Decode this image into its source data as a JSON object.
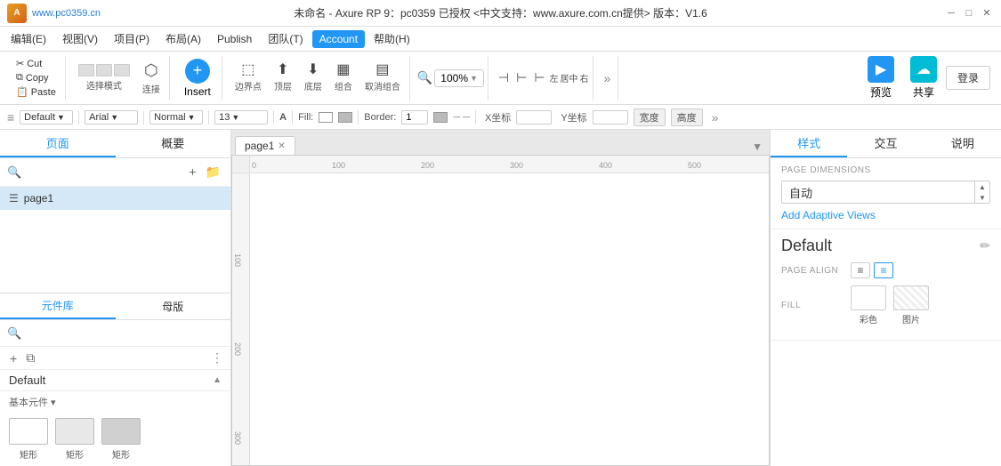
{
  "titlebar": {
    "logo_text": "A",
    "watermark": "www.pc0359.cn",
    "title": "未命名 - Axure RP 9：pc0359 已授权  <中文支持：www.axure.com.cn提供> 版本：V1.6",
    "win_controls": {
      "minimize": "─",
      "maximize": "□",
      "close": "✕"
    }
  },
  "menubar": {
    "items": [
      {
        "id": "file",
        "label": "编辑(E)"
      },
      {
        "id": "view",
        "label": "视图(V)"
      },
      {
        "id": "project",
        "label": "项目(P)"
      },
      {
        "id": "layout",
        "label": "布局(A)"
      },
      {
        "id": "publish",
        "label": "Publish"
      },
      {
        "id": "team",
        "label": "团队(T)"
      },
      {
        "id": "account",
        "label": "Account"
      },
      {
        "id": "help",
        "label": "帮助(H)"
      }
    ]
  },
  "toolbar": {
    "cut_label": "Cut",
    "copy_label": "Copy",
    "paste_label": "Paste",
    "select_mode_label": "选择模式",
    "connect_label": "连接",
    "insert_label": "Insert",
    "border_label": "边界点",
    "top_label": "顶层",
    "bottom_label": "底层",
    "group_label": "组合",
    "ungroup_label": "取消组合",
    "zoom_value": "100%",
    "left_label": "左",
    "center_label": "居中",
    "right_label": "右",
    "preview_label": "预览",
    "share_label": "共享",
    "login_label": "登录"
  },
  "formatbar": {
    "style_label": "Default",
    "font_label": "Arial",
    "style2_label": "Normal",
    "size_label": "13",
    "fill_label": "Fill:",
    "border_label": "Border:",
    "border_value": "1",
    "x_label": "X坐标",
    "y_label": "Y坐标",
    "width_label": "宽度",
    "height_label": "高度"
  },
  "left_panel": {
    "tabs": [
      {
        "id": "pages",
        "label": "页面"
      },
      {
        "id": "outline",
        "label": "概要"
      }
    ],
    "pages": [
      {
        "id": "page1",
        "label": "page1"
      }
    ],
    "bottom_tabs": [
      {
        "id": "widgets",
        "label": "元件库"
      },
      {
        "id": "masters",
        "label": "母版"
      }
    ],
    "widget_library": {
      "name": "Default",
      "category_label": "基本元件 ▾",
      "items": [
        {
          "id": "box1",
          "label": "矩形"
        },
        {
          "id": "box2",
          "label": "矩形"
        },
        {
          "id": "box3",
          "label": "矩形"
        }
      ]
    }
  },
  "canvas": {
    "tab_label": "page1",
    "ruler_marks_h": [
      "0",
      "100",
      "200",
      "300",
      "400",
      "500"
    ],
    "ruler_marks_v": [
      "100",
      "200",
      "300"
    ]
  },
  "right_panel": {
    "tabs": [
      {
        "id": "style",
        "label": "样式"
      },
      {
        "id": "interact",
        "label": "交互"
      },
      {
        "id": "notes",
        "label": "说明"
      }
    ],
    "page_dimensions": {
      "section_title": "PAGE DIMENSIONS",
      "value": "自动",
      "adaptive_views_label": "Add Adaptive Views"
    },
    "default_section": {
      "title": "Default",
      "edit_icon": "✏"
    },
    "page_align": {
      "label": "PAGE ALIGN",
      "align_left_icon": "≡",
      "align_center_icon": "≡"
    },
    "fill": {
      "label": "FILL",
      "color_label": "彩色",
      "image_label": "图片"
    }
  }
}
